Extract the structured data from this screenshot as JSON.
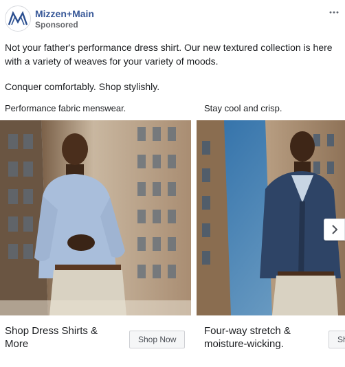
{
  "post": {
    "brand": "Mizzen+Main",
    "sponsored": "Sponsored",
    "body_line1": "Not your father's performance dress shirt. Our new textured collection is here with a variety of weaves for your variety of moods.",
    "body_line2": "Conquer comfortably. Shop stylishly."
  },
  "cards": [
    {
      "caption": "Performance fabric menswear.",
      "title": "Shop Dress Shirts & More",
      "cta": "Shop Now",
      "shirt_color": "#a9bedb",
      "pants_color": "#d9d2c2"
    },
    {
      "caption": "Stay cool and crisp.",
      "title": "Four-way stretch & moisture-wicking.",
      "cta": "Shop Now",
      "jacket_color": "#2e4466",
      "pants_color": "#d9d2c2"
    }
  ],
  "icons": {
    "more": "more-horizontal-icon",
    "next": "chevron-right-icon"
  },
  "colors": {
    "brand_link": "#385898",
    "logo": "#2a4e8f"
  }
}
